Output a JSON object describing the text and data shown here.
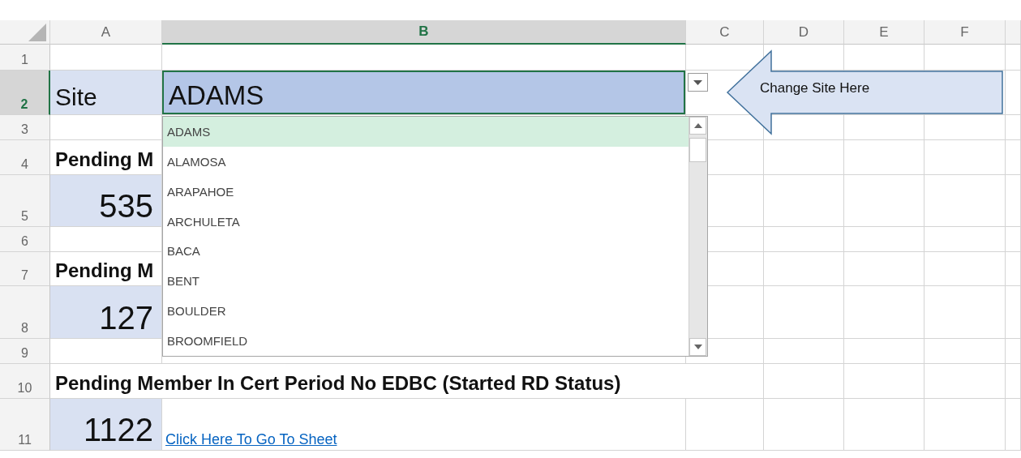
{
  "columns": [
    {
      "label": "A",
      "selected": false
    },
    {
      "label": "B",
      "selected": true
    },
    {
      "label": "C",
      "selected": false
    },
    {
      "label": "D",
      "selected": false
    },
    {
      "label": "E",
      "selected": false
    },
    {
      "label": "F",
      "selected": false
    }
  ],
  "rows": [
    {
      "number": "1",
      "selected": false
    },
    {
      "number": "2",
      "selected": true,
      "cells": [
        {
          "kind": "label",
          "text": "Site",
          "selected": false
        },
        {
          "kind": "input",
          "text": "ADAMS",
          "selected": true
        }
      ]
    },
    {
      "number": "3",
      "selected": false
    },
    {
      "number": "4",
      "selected": false,
      "cells": [
        {
          "kind": "heading",
          "text": "Pending M",
          "selected": false
        }
      ]
    },
    {
      "number": "5",
      "selected": false,
      "cells": [
        {
          "kind": "number",
          "text": "535",
          "selected": false
        }
      ]
    },
    {
      "number": "6",
      "selected": false
    },
    {
      "number": "7",
      "selected": false,
      "cells": [
        {
          "kind": "heading",
          "text": "Pending M",
          "selected": false
        }
      ]
    },
    {
      "number": "8",
      "selected": false,
      "cells": [
        {
          "kind": "number",
          "text": "127",
          "selected": false
        }
      ]
    },
    {
      "number": "9",
      "selected": false
    },
    {
      "number": "10",
      "selected": false,
      "cells": [
        {
          "kind": "wide-heading",
          "text": "Pending Member In Cert Period No EDBC (Started RD Status)",
          "selected": false
        }
      ]
    },
    {
      "number": "11",
      "selected": false,
      "cells": [
        {
          "kind": "number",
          "text": "1122",
          "selected": false
        },
        {
          "kind": "link",
          "text": "Click Here To Go To Sheet",
          "selected": false
        }
      ]
    }
  ],
  "dropdown": {
    "items": [
      {
        "text": "ADAMS",
        "selected": true
      },
      {
        "text": "ALAMOSA",
        "selected": false
      },
      {
        "text": "ARAPAHOE",
        "selected": false
      },
      {
        "text": "ARCHULETA",
        "selected": false
      },
      {
        "text": "BACA",
        "selected": false
      },
      {
        "text": "BENT",
        "selected": false
      },
      {
        "text": "BOULDER",
        "selected": false
      },
      {
        "text": "BROOMFIELD",
        "selected": false
      }
    ]
  },
  "callout": {
    "text": "Change Site Here"
  }
}
